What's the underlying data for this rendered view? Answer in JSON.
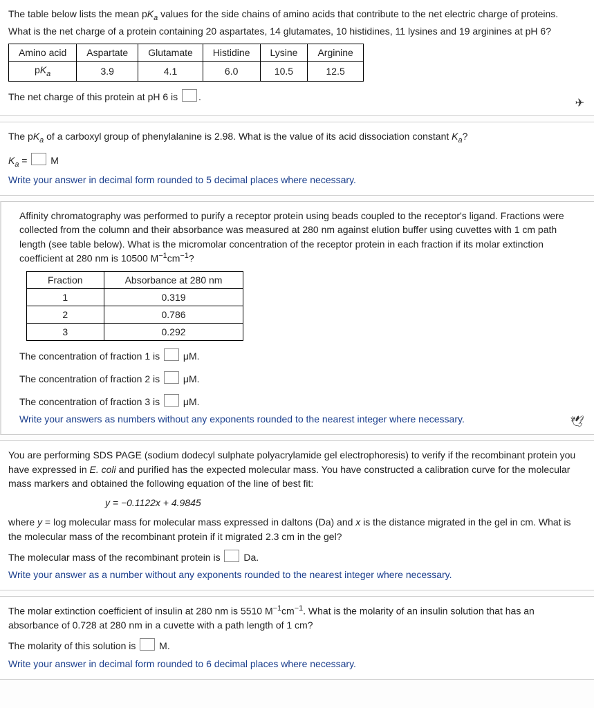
{
  "q1": {
    "intro1": "The table below lists the mean p",
    "intro1_var": "K",
    "intro1_sub": "a",
    "intro1b": " values for the side chains of amino acids that contribute to the net electric charge of proteins.",
    "intro2": "What is the net charge of a protein containing 20 aspartates, 14 glutamates, 10 histidines, 11 lysines and 19 arginines at pH 6?",
    "headers": [
      "Amino acid",
      "Aspartate",
      "Glutamate",
      "Histidine",
      "Lysine",
      "Arginine"
    ],
    "row_label": "p",
    "row_label_var": "K",
    "row_label_sub": "a",
    "values": [
      "3.9",
      "4.1",
      "6.0",
      "10.5",
      "12.5"
    ],
    "ans_pre": "The net charge of this protein at pH 6 is ",
    "ans_post": "."
  },
  "q2": {
    "text_a": "The p",
    "text_var": "K",
    "text_sub": "a",
    "text_b": " of a carboxyl group of phenylalanine is 2.98. What is the value of its acid dissociation constant ",
    "text_var2": "K",
    "text_sub2": "a",
    "text_c": "?",
    "ans_pre_var": "K",
    "ans_pre_sub": "a",
    "ans_eq": " = ",
    "ans_unit": " M",
    "hint": "Write your answer in decimal form rounded to 5 decimal places where necessary."
  },
  "q3": {
    "para": "Affinity chromatography was performed to purify a receptor protein using beads coupled to the receptor's ligand. Fractions were collected from the column and their absorbance was measured at 280 nm against elution buffer using cuvettes with 1 cm path length (see table below). What is the micromolar concentration of the receptor protein in each fraction if its molar extinction coefficient at 280 nm is 10500 M",
    "exp1": "−1",
    "mid": "cm",
    "exp2": "−1",
    "end": "?",
    "th1": "Fraction",
    "th2": "Absorbance at 280 nm",
    "rows": [
      {
        "f": "1",
        "a": "0.319"
      },
      {
        "f": "2",
        "a": "0.786"
      },
      {
        "f": "3",
        "a": "0.292"
      }
    ],
    "ans1": "The concentration of fraction 1 is ",
    "ans2": "The concentration of fraction 2 is ",
    "ans3": "The concentration of fraction 3 is ",
    "unit": " μM.",
    "hint": "Write your answers as numbers without any exponents rounded to the nearest integer where necessary."
  },
  "q4": {
    "para1a": "You are performing SDS PAGE (sodium dodecyl sulphate polyacrylamide gel electrophoresis) to verify if the recombinant protein you have expressed in ",
    "para1_ital": "E. coli",
    "para1b": " and purified has the expected molecular mass. You have constructed a calibration curve for the molecular mass markers and obtained the following equation of the line of best fit:",
    "eq": "y = −0.1122x + 4.9845",
    "para2a": "where ",
    "para2_y": "y",
    "para2b": " = log molecular mass for molecular mass expressed in daltons (Da) and ",
    "para2_x": "x",
    "para2c": " is the distance migrated in the gel in cm. What is the molecular mass of the recombinant protein if it migrated 2.3 cm in the gel?",
    "ans": "The molecular mass of the recombinant protein is ",
    "unit": " Da.",
    "hint": "Write your answer as a number without any exponents rounded to the nearest integer where necessary."
  },
  "q5": {
    "para_a": "The molar extinction coefficient of insulin at 280 nm is 5510 M",
    "exp1": "−1",
    "mid": "cm",
    "exp2": "−1",
    "para_b": ". What is the molarity of an insulin solution that has an absorbance of 0.728 at 280 nm in a cuvette with a path length of 1 cm?",
    "ans": "The molarity of this solution is ",
    "unit": " M.",
    "hint": "Write your answer in decimal form rounded to 6 decimal places where necessary."
  }
}
